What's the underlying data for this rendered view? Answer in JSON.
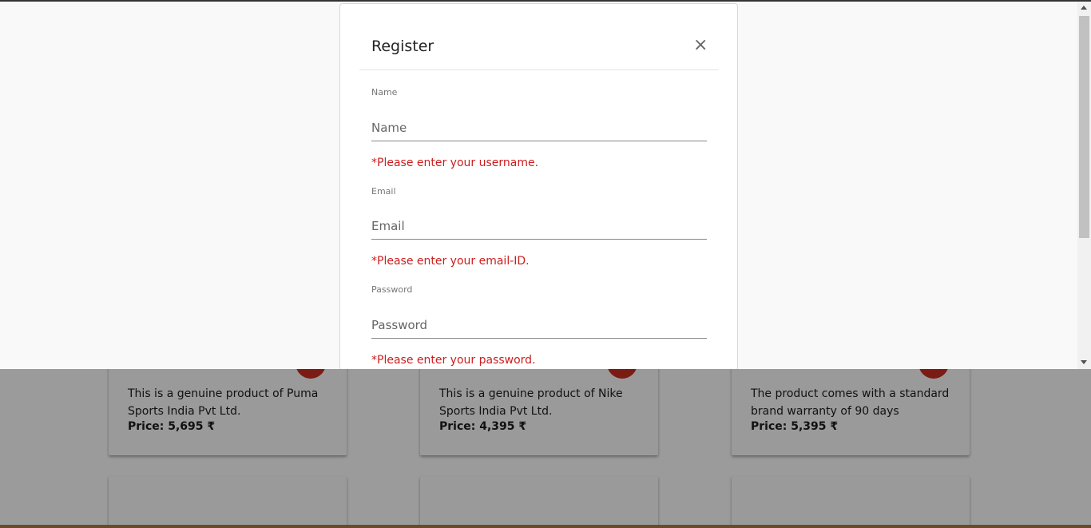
{
  "modal": {
    "title": "Register",
    "close_symbol": "×",
    "fields": [
      {
        "label": "Name",
        "placeholder": "Name",
        "value": "",
        "error": "*Please enter your username."
      },
      {
        "label": "Email",
        "placeholder": "Email",
        "value": "",
        "error": "*Please enter your email-ID."
      },
      {
        "label": "Password",
        "placeholder": "Password",
        "value": "",
        "error": "*Please enter your password."
      }
    ]
  },
  "products": [
    {
      "description": "This is a genuine product of Puma Sports India Pvt Ltd.",
      "price": "Price: 5,695 ₹"
    },
    {
      "description": "This is a genuine product of Nike Sports India Pvt Ltd.",
      "price": "Price: 4,395 ₹"
    },
    {
      "description": "The product comes with a standard brand warranty of 90 days",
      "price": "Price: 5,395 ₹"
    }
  ],
  "colors": {
    "error": "#cc1d1d",
    "fab": "#7a1c14",
    "backdrop": "#9b9b9b"
  }
}
